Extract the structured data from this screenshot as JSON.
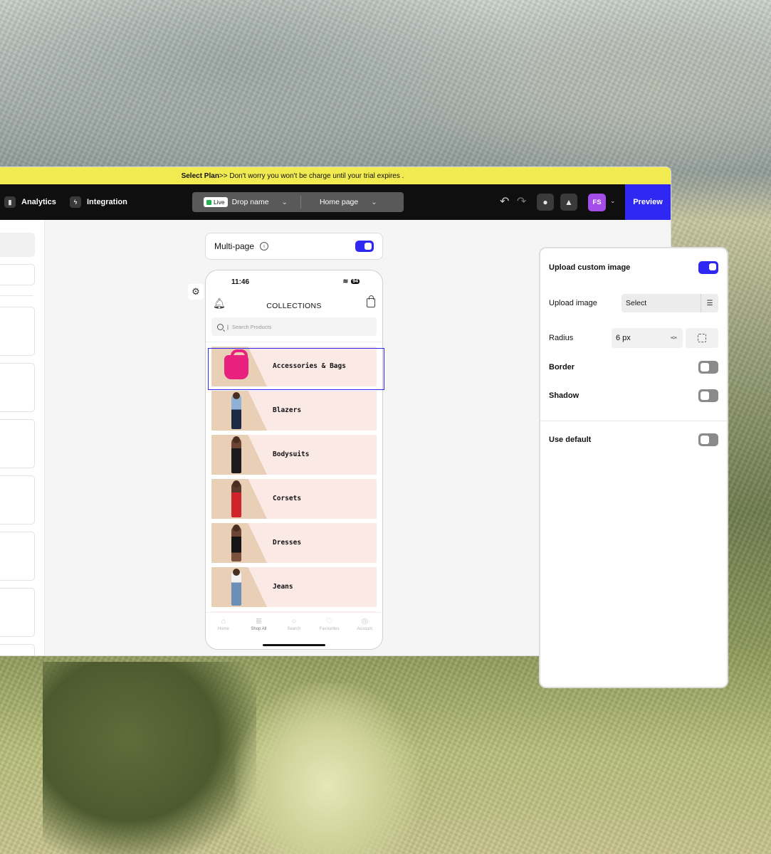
{
  "banner": {
    "strong": "Select Plan",
    "text": " >> Don't worry you won't be charge until your trial expires ."
  },
  "topbar": {
    "nav": [
      {
        "label": "Analytics",
        "icon": "analytics-icon"
      },
      {
        "label": "Integration",
        "icon": "lightning-icon"
      }
    ],
    "live_label": "Live",
    "drop_name": "Drop name",
    "page_name": "Home page",
    "avatar_initials": "FS",
    "preview_label": "Preview"
  },
  "canvas": {
    "multipage_label": "Multi-page",
    "multipage_enabled": true
  },
  "phone": {
    "time": "11:46",
    "battery": "94",
    "title": "COLLECTIONS",
    "search_placeholder": "Search Products",
    "collections": [
      {
        "label": "Accessories & Bags",
        "selected": true
      },
      {
        "label": "Blazers"
      },
      {
        "label": "Bodysuits"
      },
      {
        "label": "Corsets"
      },
      {
        "label": "Dresses"
      },
      {
        "label": "Jeans"
      }
    ],
    "tabs": [
      "Home",
      "Shop All",
      "Search",
      "Favourites",
      "Account"
    ],
    "active_tab": "Shop All"
  },
  "panel": {
    "upload_custom_image": "Upload custom image",
    "upload_custom_image_enabled": true,
    "upload_image_label": "Upload image",
    "select_label": "Select",
    "radius_label": "Radius",
    "radius_value": "6 px",
    "border_label": "Border",
    "border_enabled": false,
    "shadow_label": "Shadow",
    "shadow_enabled": false,
    "use_default_label": "Use default",
    "use_default_enabled": false
  },
  "colors": {
    "accent": "#2f27f2",
    "banner": "#f1ea50",
    "avatar": "#a44de9",
    "live": "#22b14c"
  }
}
